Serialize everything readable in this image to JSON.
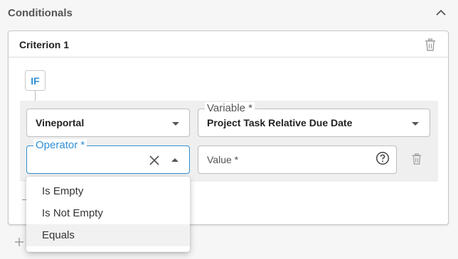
{
  "section": {
    "title": "Conditionals"
  },
  "criterion": {
    "title": "Criterion 1",
    "if_label": "IF"
  },
  "source_field": {
    "value": "Vineportal"
  },
  "variable_field": {
    "label": "Variable *",
    "value": "Project Task Relative Due Date"
  },
  "operator_field": {
    "label": "Operator *",
    "value": ""
  },
  "value_field": {
    "placeholder": "Value *"
  },
  "operator_options": [
    "Is Empty",
    "Is Not Empty",
    "Equals"
  ],
  "colors": {
    "accent": "#2d8fd5",
    "border": "#bdbdbd",
    "block_bg": "#efefef"
  }
}
